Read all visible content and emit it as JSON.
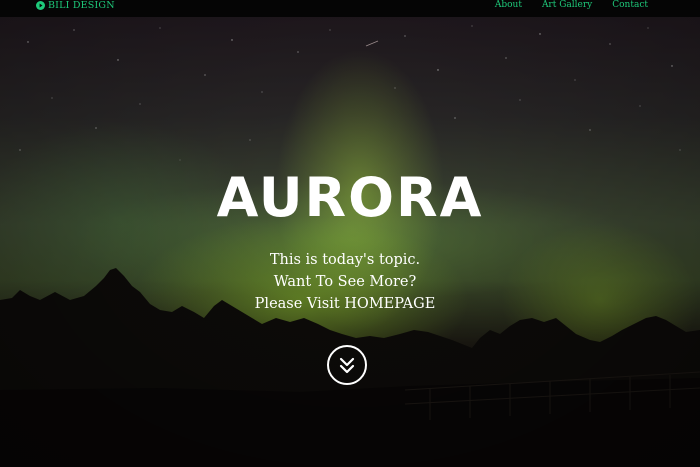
{
  "brand": {
    "label": "BILI DESIGN",
    "icon": "play-circle-icon"
  },
  "nav": {
    "items": [
      {
        "label": "About"
      },
      {
        "label": "Art Gallery"
      },
      {
        "label": "Contact"
      }
    ]
  },
  "hero": {
    "title": "AURORA",
    "subtitle_lines": [
      "This is today's topic.",
      "Want To See More?",
      "Please Visit HOMEPAGE"
    ],
    "scroll_icon": "double-chevron-down-icon",
    "background": "night-sky-aurora-photo"
  },
  "colors": {
    "accent": "#1ec97a",
    "topbar": "#050505",
    "text": "#ffffff"
  }
}
